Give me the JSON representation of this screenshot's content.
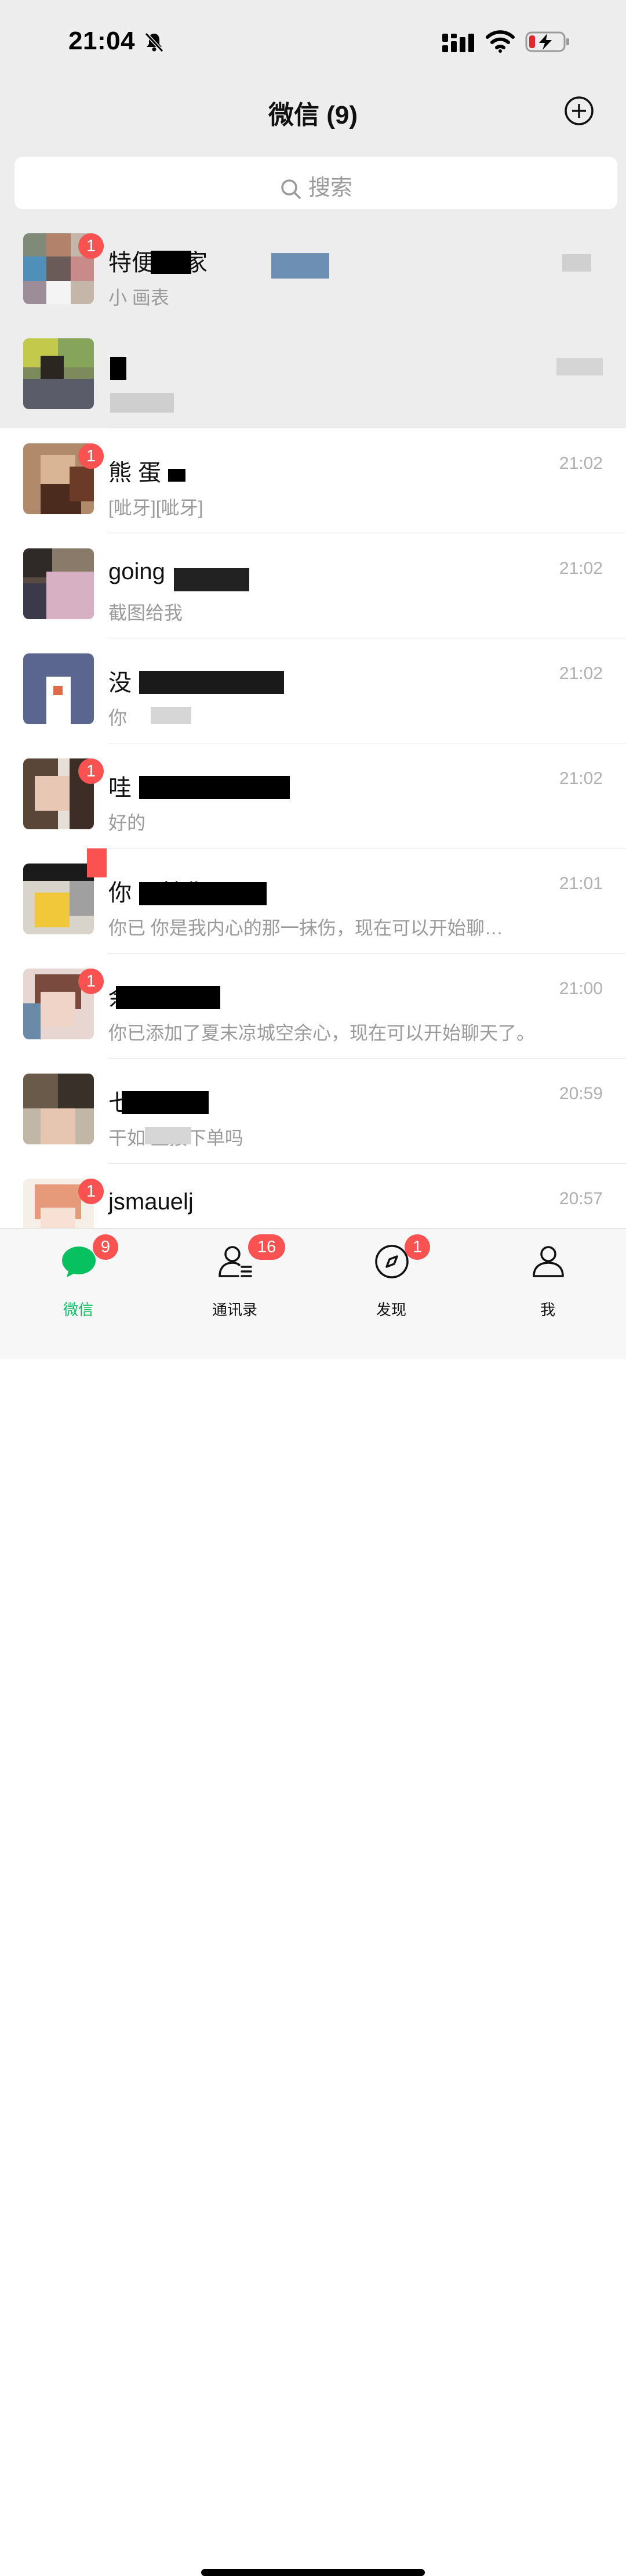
{
  "status_bar": {
    "time": "21:04"
  },
  "nav": {
    "title": "微信 (9)",
    "add_icon": "plus-circle-icon"
  },
  "search": {
    "placeholder": "搜索",
    "icon": "search-icon"
  },
  "chats": [
    {
      "name": "特便 商家",
      "preview": "小 画表",
      "time": "",
      "badge": "1",
      "pinned": true
    },
    {
      "name": "",
      "preview": "",
      "time": "",
      "badge": "",
      "pinned": true
    },
    {
      "name": "熊 蛋",
      "preview": "[呲牙][呲牙]",
      "time": "21:02",
      "badge": "1",
      "pinned": false
    },
    {
      "name": "going",
      "preview": "截图给我",
      "time": "21:02",
      "badge": "",
      "pinned": false
    },
    {
      "name": "没 转",
      "preview": "你",
      "time": "21:02",
      "badge": "",
      "pinned": false
    },
    {
      "name": "哇",
      "preview": "好的",
      "time": "21:02",
      "badge": "1",
      "pinned": false
    },
    {
      "name": "你 一抹伤",
      "preview": "你已 你是我内心的那一抹伤，现在可以开始聊…",
      "time": "21:01",
      "badge": "",
      "pinned": false
    },
    {
      "name": "余心",
      "preview": "你已添加了夏末凉城空余心，现在可以开始聊天了。",
      "time": "21:00",
      "badge": "1",
      "pinned": false
    },
    {
      "name": "七",
      "preview": "干如 直接下单吗",
      "time": "20:59",
      "badge": "",
      "pinned": false
    },
    {
      "name": "jsmauelj",
      "preview": "",
      "time": "20:57",
      "badge": "1",
      "pinned": false
    }
  ],
  "tabs": [
    {
      "label": "微信",
      "icon": "chat-bubble-icon",
      "badge": "9",
      "active": true
    },
    {
      "label": "通讯录",
      "icon": "contacts-icon",
      "badge": "16",
      "active": false
    },
    {
      "label": "发现",
      "icon": "compass-icon",
      "badge": "1",
      "active": false
    },
    {
      "label": "我",
      "icon": "person-icon",
      "badge": "",
      "active": false
    }
  ],
  "colors": {
    "accent": "#07c160",
    "badge": "#fa5151",
    "header_bg": "#ededed"
  }
}
